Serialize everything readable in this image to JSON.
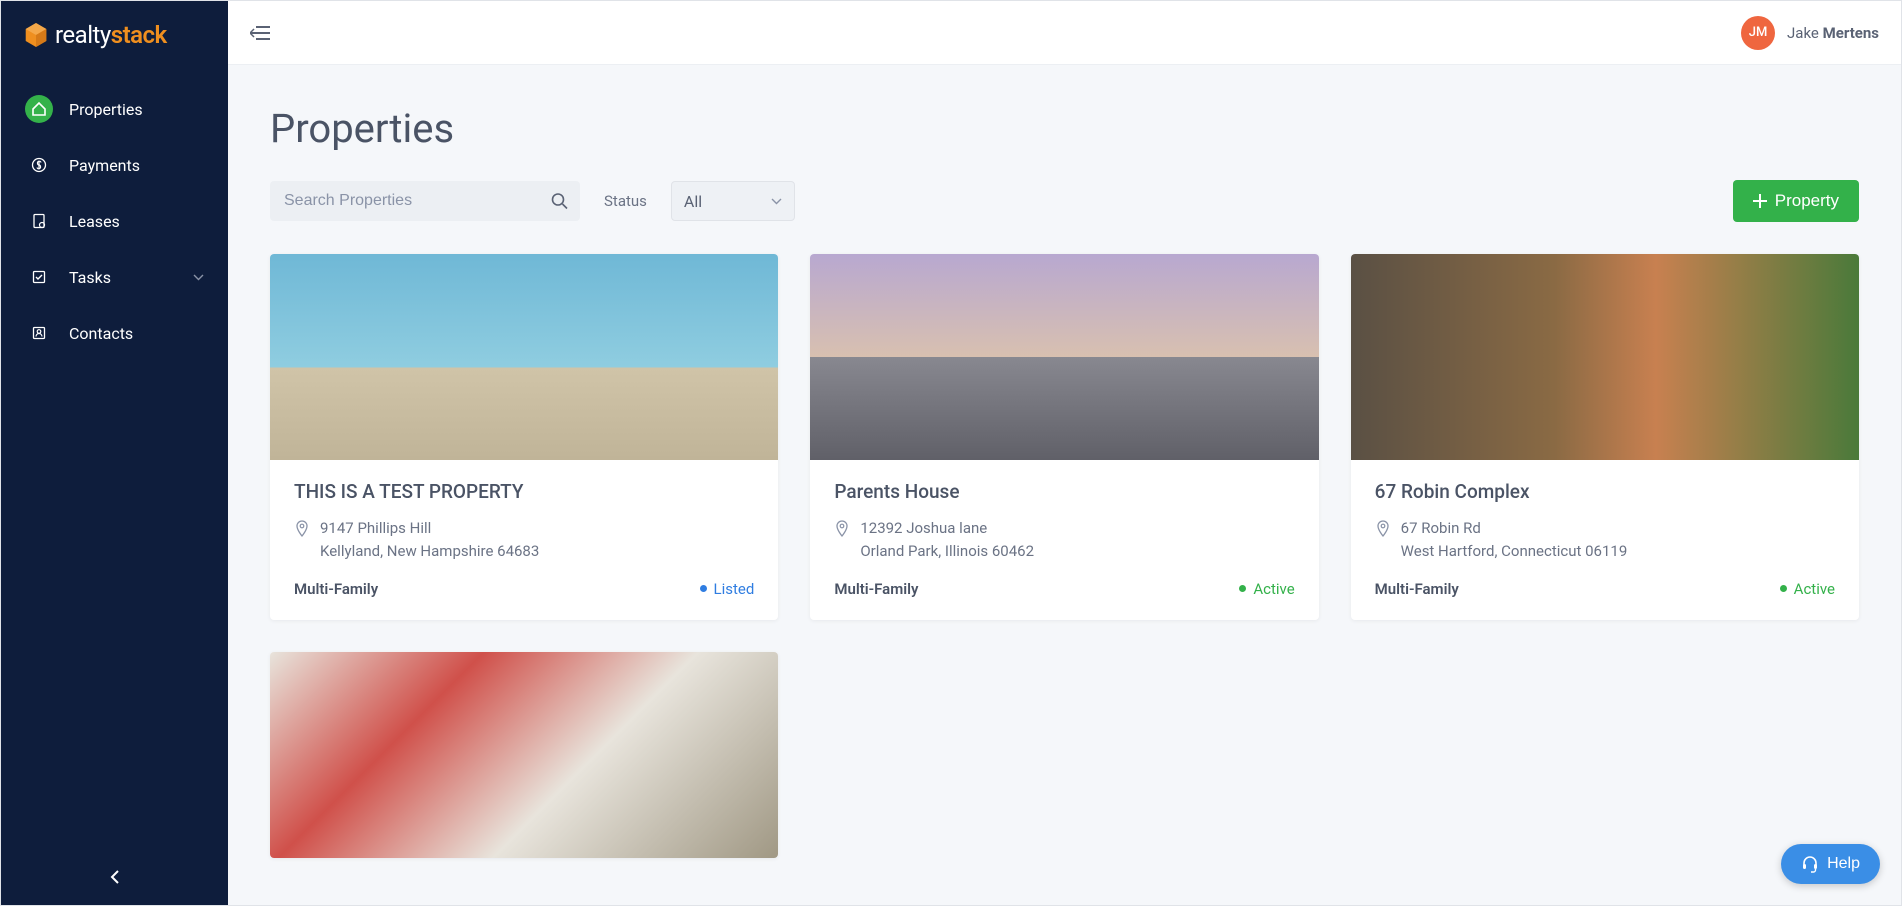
{
  "brand": {
    "part1": "realty",
    "part2": "stack"
  },
  "sidebar": {
    "items": [
      {
        "label": "Properties",
        "icon": "home-icon",
        "active": true
      },
      {
        "label": "Payments",
        "icon": "dollar-icon"
      },
      {
        "label": "Leases",
        "icon": "document-icon"
      },
      {
        "label": "Tasks",
        "icon": "checklist-icon",
        "expandable": true
      },
      {
        "label": "Contacts",
        "icon": "contacts-icon"
      }
    ]
  },
  "user": {
    "initials": "JM",
    "first": "Jake",
    "last": "Mertens"
  },
  "page": {
    "title": "Properties"
  },
  "search": {
    "placeholder": "Search Properties"
  },
  "filter": {
    "label": "Status",
    "selected": "All"
  },
  "add_button": {
    "label": "Property"
  },
  "properties": [
    {
      "title": "THIS IS A TEST PROPERTY",
      "addr1": "9147 Phillips Hill",
      "addr2": "Kellyland, New Hampshire 64683",
      "type": "Multi-Family",
      "status": "Listed",
      "status_class": "listed",
      "img": "img1"
    },
    {
      "title": "Parents House",
      "addr1": "12392 Joshua lane",
      "addr2": "Orland Park, Illinois 60462",
      "type": "Multi-Family",
      "status": "Active",
      "status_class": "active",
      "img": "img2"
    },
    {
      "title": "67 Robin Complex",
      "addr1": "67 Robin Rd",
      "addr2": "West Hartford, Connecticut 06119",
      "type": "Multi-Family",
      "status": "Active",
      "status_class": "active",
      "img": "img3"
    },
    {
      "title": "",
      "addr1": "",
      "addr2": "",
      "type": "",
      "status": "",
      "status_class": "",
      "img": "img4",
      "partial": true
    }
  ],
  "help": {
    "label": "Help"
  }
}
